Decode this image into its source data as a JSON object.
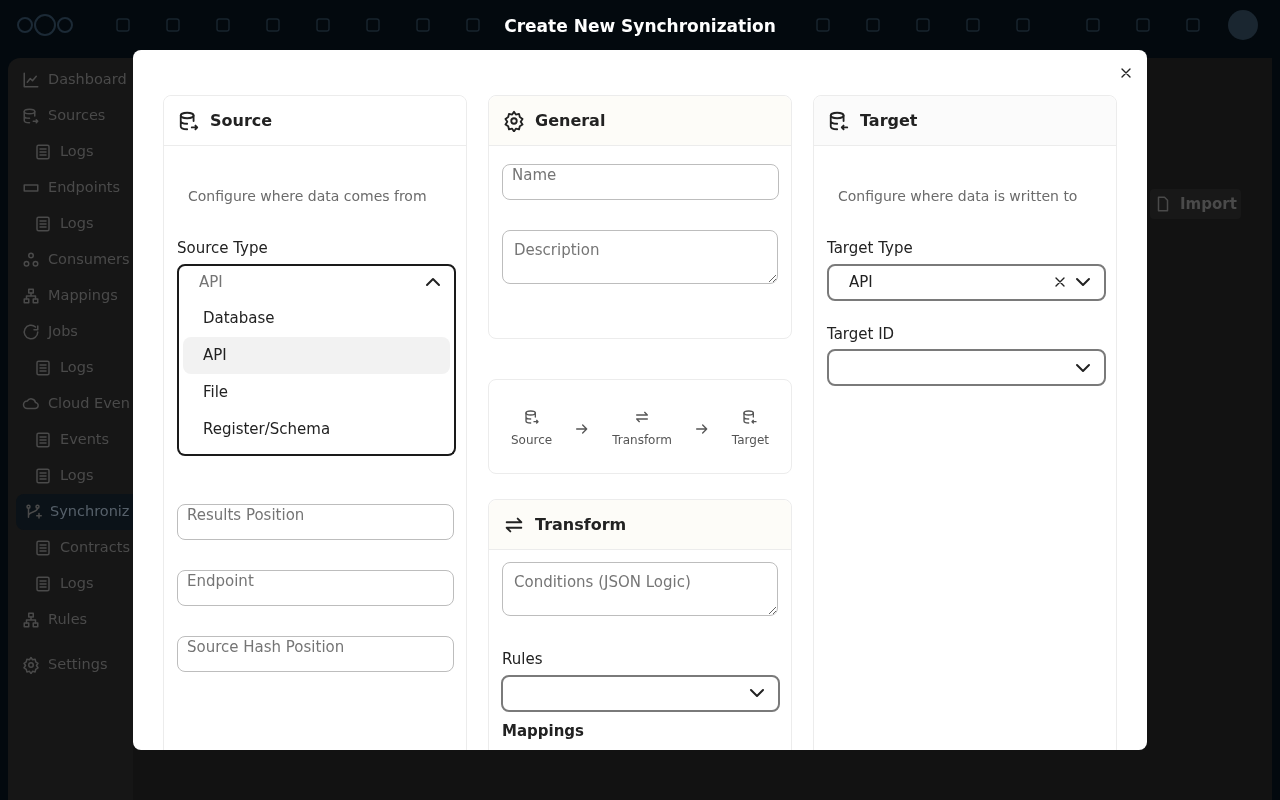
{
  "top_bar": {
    "title": "Create New Synchronization"
  },
  "sidebar": {
    "items": [
      {
        "label": "Dashboard",
        "selected": false
      },
      {
        "label": "Sources",
        "selected": false,
        "children": [
          {
            "label": "Logs",
            "selected": false
          }
        ]
      },
      {
        "label": "Endpoints",
        "selected": false,
        "children": [
          {
            "label": "Logs",
            "selected": false
          }
        ]
      },
      {
        "label": "Consumers",
        "selected": false
      },
      {
        "label": "Mappings",
        "selected": false
      },
      {
        "label": "Jobs",
        "selected": false,
        "children": [
          {
            "label": "Logs",
            "selected": false
          }
        ]
      },
      {
        "label": "Cloud Even",
        "selected": false,
        "children": [
          {
            "label": "Events",
            "selected": false
          },
          {
            "label": "Logs",
            "selected": false
          }
        ]
      },
      {
        "label": "Synchroniz",
        "selected": true,
        "children": [
          {
            "label": "Contracts",
            "selected": false
          },
          {
            "label": "Logs",
            "selected": false
          }
        ]
      },
      {
        "label": "Rules",
        "selected": false
      },
      {
        "label": "Settings",
        "selected": false
      }
    ]
  },
  "import_button": "Import",
  "source": {
    "heading": "Source",
    "description": "Configure where data comes from",
    "source_type": {
      "label": "Source Type",
      "value": "API",
      "expanded": true,
      "options": [
        {
          "label": "Database",
          "selected": false
        },
        {
          "label": "API",
          "selected": true
        },
        {
          "label": "File",
          "selected": false
        },
        {
          "label": "Register/Schema",
          "selected": false
        }
      ]
    },
    "fields": [
      {
        "placeholder": "Results Position"
      },
      {
        "placeholder": "Endpoint"
      },
      {
        "placeholder": "Source Hash Position"
      }
    ]
  },
  "general": {
    "heading": "General",
    "fields": [
      {
        "kind": "input",
        "placeholder": "Name"
      },
      {
        "kind": "textarea",
        "placeholder": "Description"
      }
    ]
  },
  "flow": {
    "steps": [
      "Source",
      "Transform",
      "Target"
    ]
  },
  "transform": {
    "heading": "Transform",
    "fields": [
      {
        "kind": "textarea",
        "placeholder": "Conditions (JSON Logic)"
      }
    ],
    "rules": {
      "label": "Rules",
      "expanded": false
    },
    "mappings_label": "Mappings"
  },
  "target": {
    "heading": "Target",
    "description": "Configure where data is written to",
    "target_type": {
      "label": "Target Type",
      "value": "API",
      "clearable": true,
      "expanded": false
    },
    "target_id": {
      "label": "Target ID",
      "expanded": false
    }
  }
}
